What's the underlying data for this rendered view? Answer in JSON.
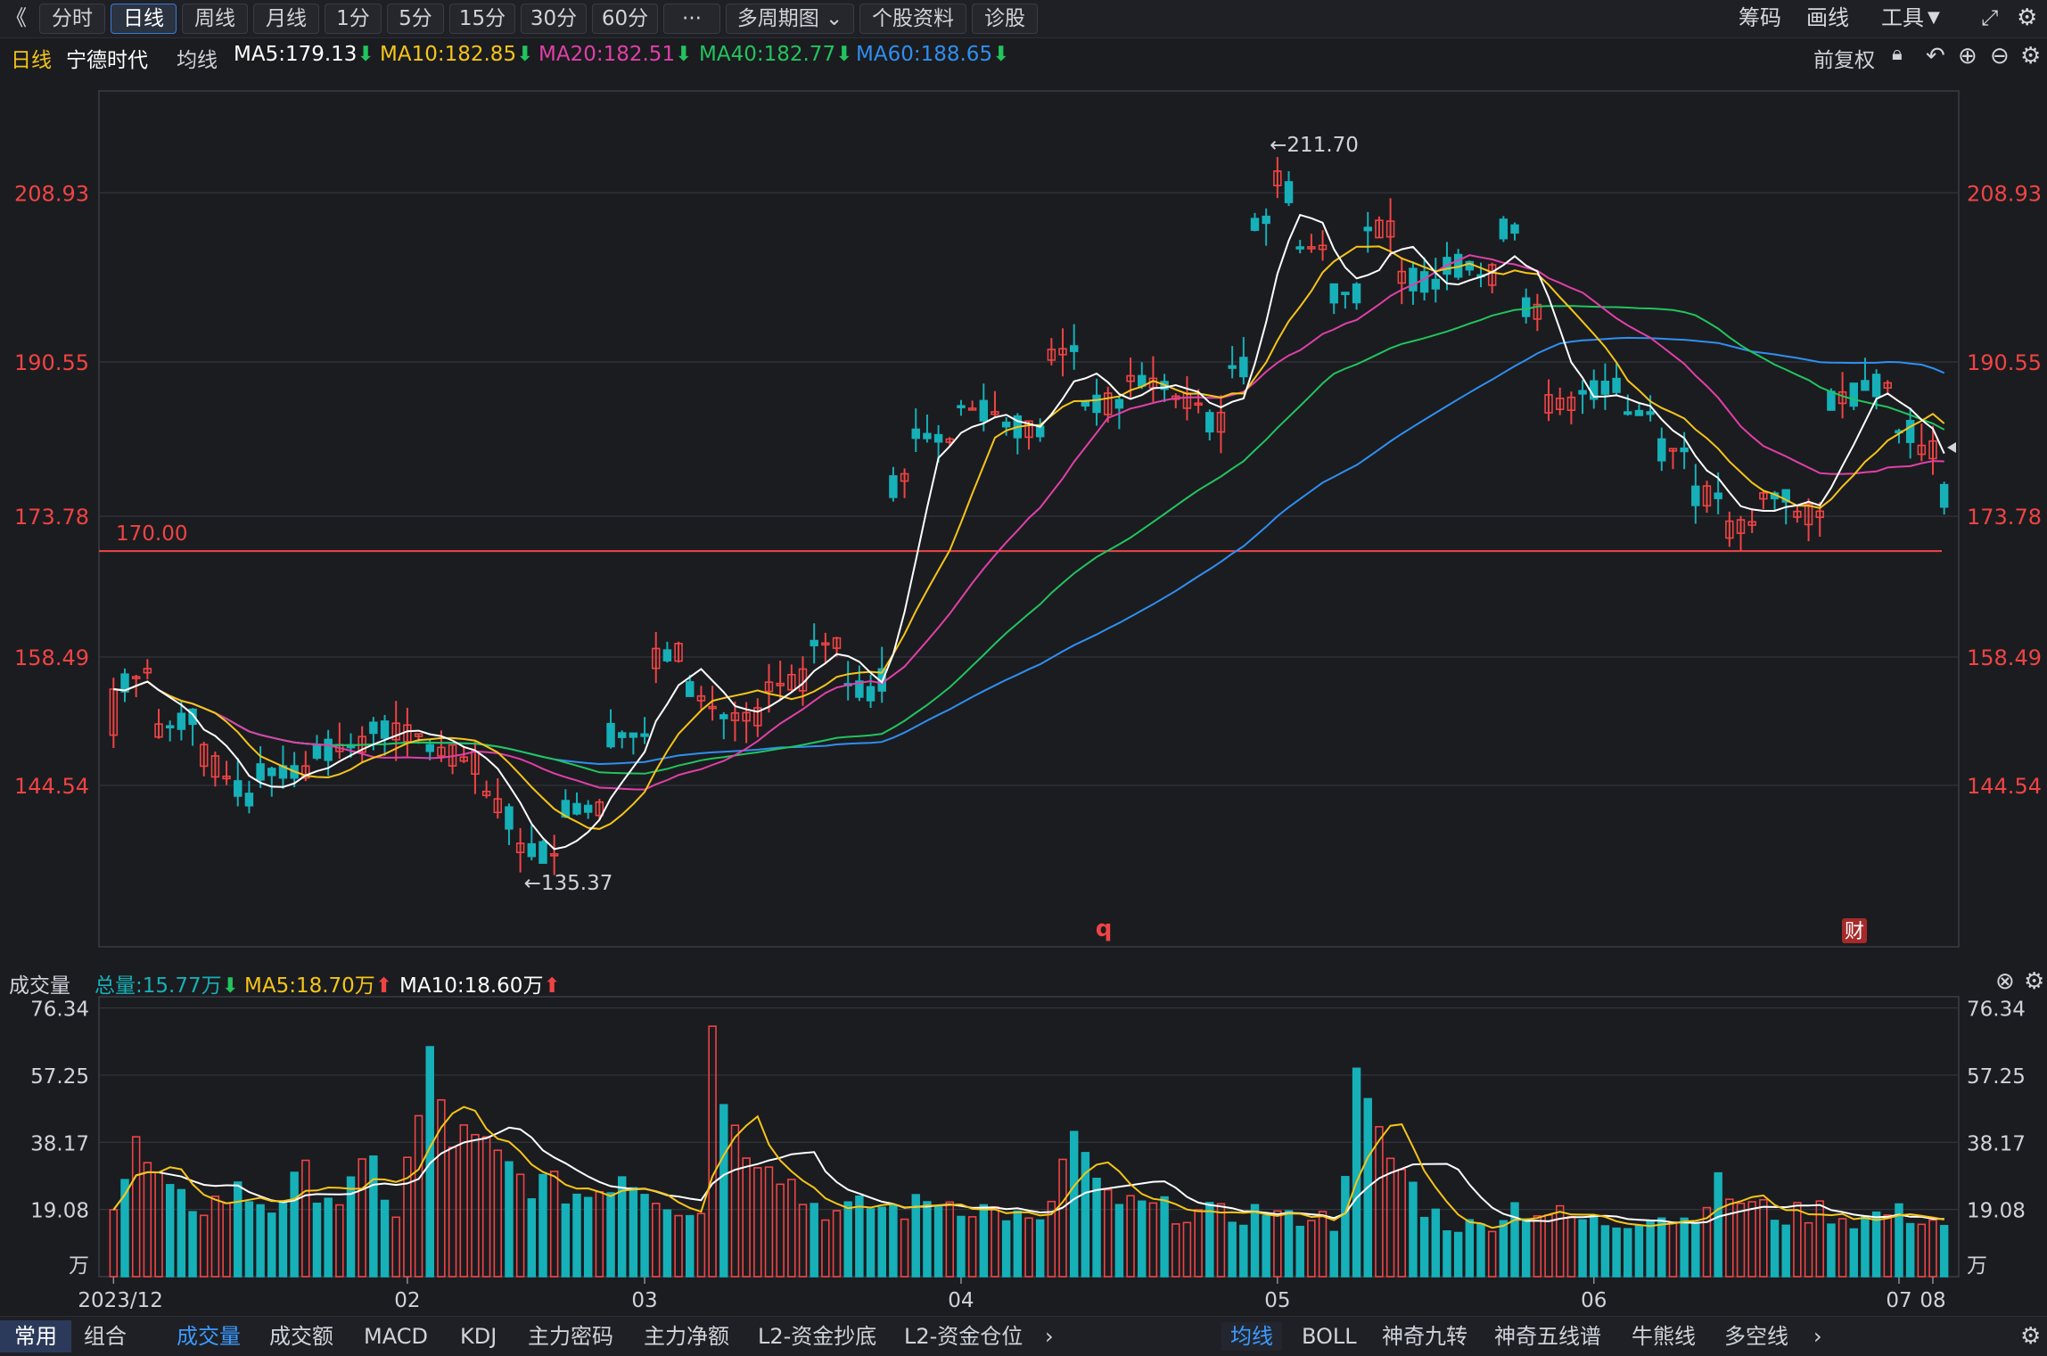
{
  "toolbar": {
    "back": "《",
    "tabs": [
      "分时",
      "日线",
      "周线",
      "月线",
      "1分",
      "5分",
      "15分",
      "30分",
      "60分",
      "···",
      "多周期图",
      "个股资料",
      "诊股"
    ],
    "active_tab": "日线",
    "right": [
      "筹码",
      "画线",
      "工具"
    ]
  },
  "ma_bar": {
    "period": "日线",
    "stock": "宁德时代",
    "label": "均线",
    "ma5": "MA5:179.13",
    "ma10": "MA10:182.85",
    "ma20": "MA20:182.51",
    "ma40": "MA40:182.77",
    "ma60": "MA60:188.65",
    "adjust": "前复权"
  },
  "vol_bar": {
    "label": "成交量",
    "total": "总量:15.77万",
    "ma5": "MA5:18.70万",
    "ma10": "MA10:18.60万"
  },
  "bottom": {
    "left_tabs": [
      "常用",
      "组合"
    ],
    "indicators": [
      "成交量",
      "成交额",
      "MACD",
      "KDJ",
      "主力密码",
      "主力净额",
      "L2-资金抄底",
      "L2-资金仓位"
    ],
    "overlays": [
      "均线",
      "BOLL",
      "神奇九转",
      "神奇五线谱",
      "牛熊线",
      "多空线"
    ]
  },
  "colors": {
    "up": "#ef4444",
    "down": "#16b0b8",
    "ma5": "#ffffff",
    "ma10": "#f5c518",
    "ma20": "#e040a8",
    "ma40": "#22c45e",
    "ma60": "#2f8ff0"
  },
  "chart_data": {
    "type": "candlestick",
    "y_ticks": [
      "208.93",
      "190.55",
      "173.78",
      "158.49",
      "144.54"
    ],
    "vol_ticks": [
      "76.34",
      "57.25",
      "38.17",
      "19.08",
      "万"
    ],
    "x_ticks": [
      "2023/12",
      "02",
      "03",
      "04",
      "05",
      "06",
      "07",
      "08"
    ],
    "hline": "170.00",
    "high_label": "←211.70",
    "low_label": "←135.37",
    "marker_q": "q",
    "marker_cai": "财",
    "ylim": [
      127,
      220
    ],
    "vol_max": 78,
    "anchors": [
      [
        0,
        150,
        155
      ],
      [
        3,
        157,
        150
      ],
      [
        7,
        152,
        149
      ],
      [
        12,
        143,
        146
      ],
      [
        17,
        146,
        148
      ],
      [
        22,
        149,
        151
      ],
      [
        27,
        150,
        149
      ],
      [
        32,
        147,
        145
      ],
      [
        35,
        141,
        138
      ],
      [
        39,
        137,
        142
      ],
      [
        43,
        142,
        150
      ],
      [
        47,
        150,
        158
      ],
      [
        50,
        159,
        156
      ],
      [
        53,
        153,
        152
      ],
      [
        57,
        152,
        155
      ],
      [
        61,
        156,
        160
      ],
      [
        64,
        160,
        156
      ],
      [
        66,
        155,
        153
      ],
      [
        68,
        156,
        176
      ],
      [
        70,
        178,
        183
      ],
      [
        74,
        182,
        186
      ],
      [
        78,
        185,
        184
      ],
      [
        82,
        183,
        191
      ],
      [
        85,
        192,
        186
      ],
      [
        89,
        186,
        189
      ],
      [
        93,
        188,
        187
      ],
      [
        96,
        186,
        184
      ],
      [
        98,
        184,
        190
      ],
      [
        100,
        190,
        205
      ],
      [
        102,
        206,
        212
      ],
      [
        104,
        209,
        203
      ],
      [
        107,
        203,
        198
      ],
      [
        110,
        198,
        205
      ],
      [
        113,
        205,
        200
      ],
      [
        117,
        199,
        201
      ],
      [
        120,
        201,
        200
      ],
      [
        122,
        200,
        205
      ],
      [
        124,
        205,
        197
      ],
      [
        126,
        196,
        186
      ],
      [
        129,
        186,
        187
      ],
      [
        133,
        188,
        185
      ],
      [
        136,
        185,
        181
      ],
      [
        139,
        181,
        176
      ],
      [
        142,
        176,
        172
      ],
      [
        145,
        173,
        176
      ],
      [
        148,
        176,
        174
      ],
      [
        151,
        174,
        186
      ],
      [
        154,
        187,
        188
      ],
      [
        157,
        188,
        183
      ],
      [
        159,
        183,
        181
      ],
      [
        161,
        181,
        176
      ],
      [
        162,
        176,
        174
      ]
    ],
    "volume_anchors": [
      [
        0,
        19
      ],
      [
        2,
        36
      ],
      [
        5,
        22
      ],
      [
        8,
        20
      ],
      [
        11,
        24
      ],
      [
        14,
        20
      ],
      [
        17,
        28
      ],
      [
        20,
        22
      ],
      [
        23,
        31
      ],
      [
        25,
        18
      ],
      [
        28,
        58
      ],
      [
        30,
        40
      ],
      [
        33,
        35
      ],
      [
        36,
        28
      ],
      [
        39,
        25
      ],
      [
        42,
        23
      ],
      [
        45,
        30
      ],
      [
        48,
        24
      ],
      [
        50,
        20
      ],
      [
        52,
        18
      ],
      [
        53,
        76
      ],
      [
        55,
        40
      ],
      [
        58,
        36
      ],
      [
        61,
        22
      ],
      [
        64,
        18
      ],
      [
        67,
        20
      ],
      [
        70,
        19
      ],
      [
        73,
        22
      ],
      [
        76,
        20
      ],
      [
        79,
        18
      ],
      [
        82,
        14
      ],
      [
        85,
        40
      ],
      [
        87,
        24
      ],
      [
        90,
        20
      ],
      [
        93,
        19
      ],
      [
        96,
        18
      ],
      [
        99,
        17
      ],
      [
        102,
        19
      ],
      [
        104,
        16
      ],
      [
        106,
        18
      ],
      [
        108,
        15
      ],
      [
        110,
        52
      ],
      [
        112,
        38
      ],
      [
        114,
        30
      ],
      [
        116,
        20
      ],
      [
        118,
        15
      ],
      [
        121,
        14
      ],
      [
        124,
        20
      ],
      [
        127,
        18
      ],
      [
        130,
        16
      ],
      [
        133,
        15
      ],
      [
        136,
        18
      ],
      [
        139,
        16
      ],
      [
        142,
        25
      ],
      [
        145,
        20
      ],
      [
        148,
        17
      ],
      [
        151,
        19
      ],
      [
        154,
        16
      ],
      [
        157,
        18
      ],
      [
        160,
        17
      ],
      [
        162,
        15
      ]
    ]
  }
}
